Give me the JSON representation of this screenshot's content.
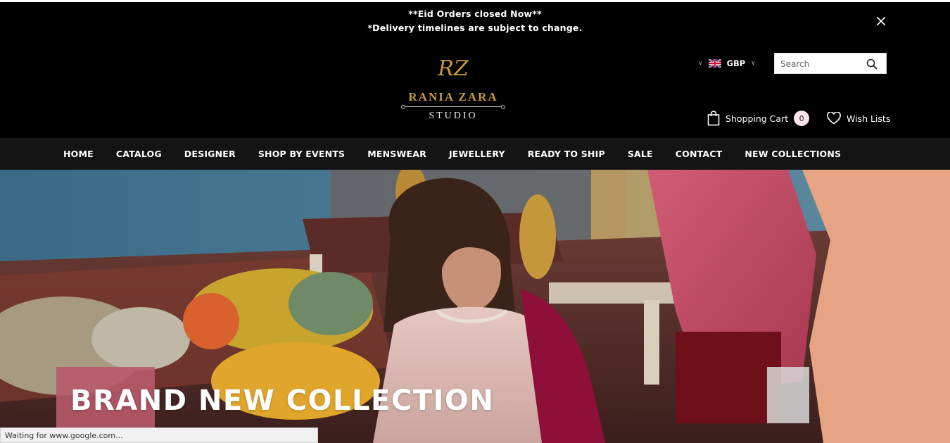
{
  "announcement": {
    "line1": "**Eid Orders closed Now**",
    "line2": "*Delivery timelines are subject to change."
  },
  "brand": {
    "monogram": "RZ",
    "name": "RANIA ZARA",
    "subtitle": "STUDIO",
    "gold": "#c79a3c"
  },
  "currency": {
    "code": "GBP",
    "flag": "uk-flag-icon"
  },
  "search": {
    "placeholder": "Search"
  },
  "cart": {
    "label": "Shopping Cart",
    "count": "0"
  },
  "wishlist": {
    "label": "Wish Lists"
  },
  "nav": {
    "items": [
      {
        "label": "HOME"
      },
      {
        "label": "CATALOG"
      },
      {
        "label": "DESIGNER"
      },
      {
        "label": "SHOP BY EVENTS"
      },
      {
        "label": "MENSWEAR"
      },
      {
        "label": "JEWELLERY"
      },
      {
        "label": "READY TO SHIP"
      },
      {
        "label": "SALE"
      },
      {
        "label": "CONTACT"
      },
      {
        "label": "NEW COLLECTIONS"
      }
    ]
  },
  "hero": {
    "title": "BRAND NEW COLLECTION"
  },
  "status_bar": {
    "text": "Waiting for www.google.com..."
  }
}
